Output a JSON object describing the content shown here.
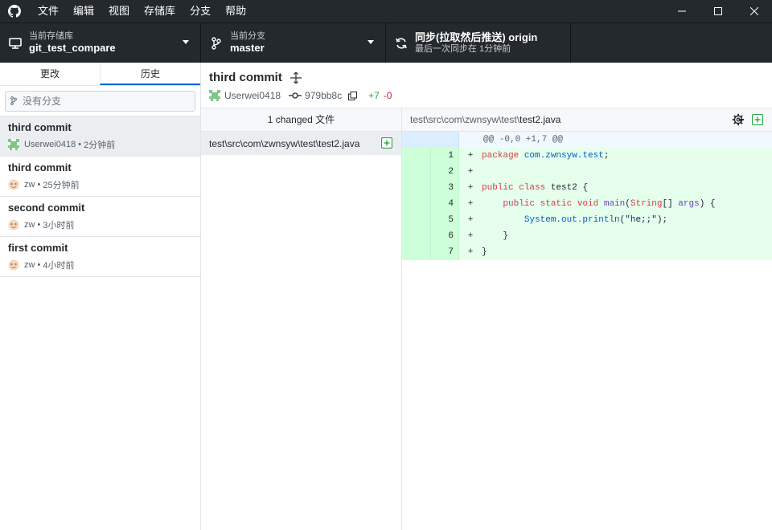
{
  "menu": [
    "文件",
    "编辑",
    "视图",
    "存储库",
    "分支",
    "帮助"
  ],
  "toolbar": {
    "repo": {
      "desc": "当前存储库",
      "name": "git_test_compare"
    },
    "branch": {
      "desc": "当前分支",
      "name": "master"
    },
    "sync": {
      "title": "同步(拉取然后推送) origin",
      "desc": "最后一次同步在 1分钟前"
    }
  },
  "tabs": {
    "changes": "更改",
    "history": "历史"
  },
  "filter": {
    "placeholder": "没有分支"
  },
  "commits": [
    {
      "title": "third commit",
      "author": "Userwei0418",
      "time": "2分钟前"
    },
    {
      "title": "third commit",
      "author": "zw",
      "time": "25分钟前"
    },
    {
      "title": "second commit",
      "author": "zw",
      "time": "3小时前"
    },
    {
      "title": "first commit",
      "author": "zw",
      "time": "4小时前"
    }
  ],
  "commit_detail": {
    "title": "third commit",
    "author": "Userwei0418",
    "sha": "979bb8c",
    "additions": "+7",
    "deletions": "-0"
  },
  "files": {
    "header": "1 changed 文件",
    "items": [
      {
        "path": "test\\src\\com\\zwnsyw\\test\\test2.java"
      }
    ]
  },
  "diff": {
    "path_prefix": "test\\src\\com\\zwnsyw\\test\\",
    "path_file": "test2.java",
    "hunk": "@@ -0,0 +1,7 @@",
    "lines": [
      {
        "num": "1",
        "marker": "+",
        "code": "package com.zwnsyw.test;"
      },
      {
        "num": "2",
        "marker": "+",
        "code": ""
      },
      {
        "num": "3",
        "marker": "+",
        "code": "public class test2 {"
      },
      {
        "num": "4",
        "marker": "+",
        "code": "    public static void main(String[] args) {"
      },
      {
        "num": "5",
        "marker": "+",
        "code": "        System.out.println(\"he;;\");"
      },
      {
        "num": "6",
        "marker": "+",
        "code": "    }"
      },
      {
        "num": "7",
        "marker": "+",
        "code": "}"
      }
    ]
  },
  "colors": {
    "accent": "#0366d6",
    "addition": "#28a745",
    "deletion": "#cb2431",
    "chrome": "#24292e"
  },
  "icons": {
    "app": "github-icon",
    "repo": "desktop-icon",
    "branch": "branch-icon",
    "sync": "sync-icon",
    "commit_sha": "commit-icon",
    "copy": "copy-icon",
    "settings": "gear-icon",
    "file_added": "file-added-icon"
  }
}
